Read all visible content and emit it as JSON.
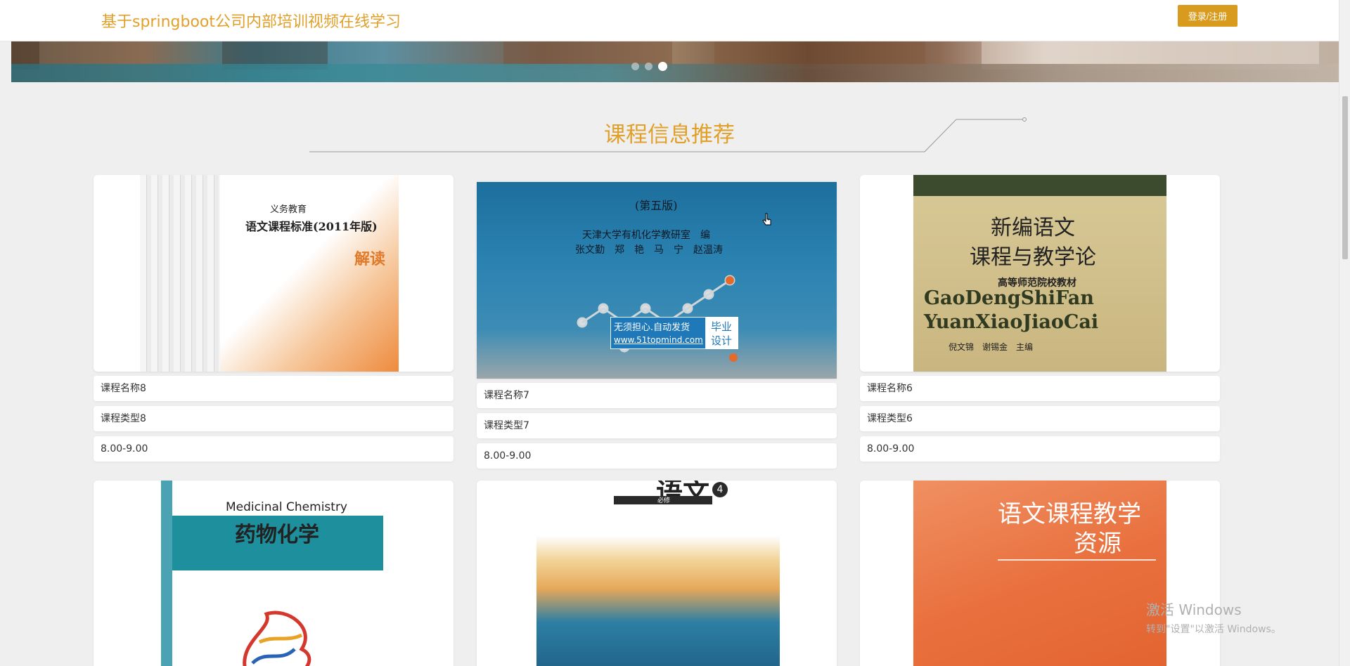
{
  "header": {
    "site_title": "基于springboot公司内部培训视频在线学习",
    "login_label": "登录/注册",
    "accent": "#e0a02a"
  },
  "carousel": {
    "dots": 3,
    "active": 2
  },
  "section": {
    "title": "课程信息推荐"
  },
  "courses": [
    {
      "name": "课程名称8",
      "type": "课程类型8",
      "time": "8.00-9.00",
      "cover": {
        "lines": [
          "义务教育",
          "语文课程标准(2011年版)",
          "解读"
        ]
      }
    },
    {
      "name": "课程名称7",
      "type": "课程类型7",
      "time": "8.00-9.00",
      "cover": {
        "lines": [
          "(第五版)",
          "天津大学有机化学教研室　编",
          "张文勤　郑　艳　马　宁　赵温涛"
        ],
        "badge_line1": "无须担心.自动发货",
        "badge_line2": "www.51topmind.com",
        "badge_right1": "毕业",
        "badge_right2": "设计"
      }
    },
    {
      "name": "课程名称6",
      "type": "课程类型6",
      "time": "8.00-9.00",
      "cover": {
        "lines": [
          "新编语文",
          "课程与教学论",
          "高等师范院校教材",
          "GaoDengShiFan",
          "YuanXiaoJiaoCai",
          "倪文锦　谢锡金　主编"
        ]
      }
    },
    {
      "cover": {
        "lines": [
          "Medicinal Chemistry",
          "药物化学"
        ]
      }
    },
    {
      "cover": {
        "lines": [
          "语文",
          "必修",
          "4"
        ]
      }
    },
    {
      "cover": {
        "lines": [
          "语文课程教学",
          "资源"
        ]
      }
    }
  ],
  "os_watermark": {
    "line1": "激活 Windows",
    "line2": "转到\"设置\"以激活 Windows。"
  }
}
